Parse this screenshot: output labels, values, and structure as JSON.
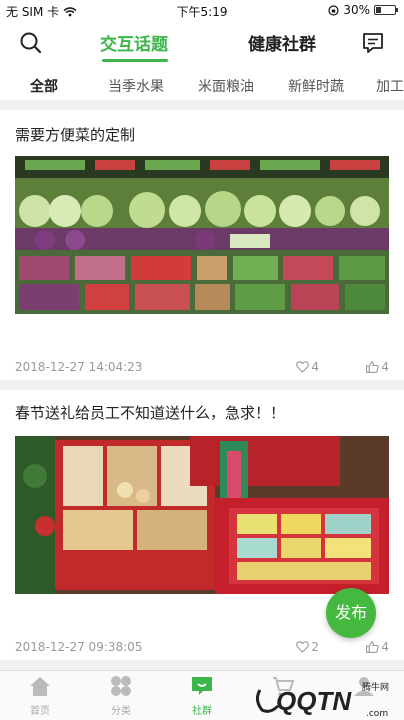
{
  "status": {
    "carrier": "无 SIM 卡",
    "time": "下午5:19",
    "battery": "30%",
    "battery_level": 0.3
  },
  "header": {
    "tabs": [
      {
        "label": "交互话题",
        "active": true
      },
      {
        "label": "健康社群",
        "active": false
      }
    ],
    "icons": {
      "search": "search-icon",
      "message": "message-icon"
    }
  },
  "categories": [
    "全部",
    "当季水果",
    "米面粮油",
    "新鲜时蔬",
    "加工"
  ],
  "posts": [
    {
      "title": "需要方便菜的定制",
      "date": "2018-12-27 14:04:23",
      "likes": "4",
      "thumbs": "4"
    },
    {
      "title": "春节送礼给员工不知道送什么，急求！！",
      "date": "2018-12-27 09:38:05",
      "likes": "2",
      "thumbs": "4"
    }
  ],
  "publish_label": "发布",
  "bottom_nav": [
    {
      "label": "首页",
      "icon": "home-icon",
      "active": false
    },
    {
      "label": "分类",
      "icon": "category-icon",
      "active": false
    },
    {
      "label": "社群",
      "icon": "community-icon",
      "active": true
    },
    {
      "label": "",
      "icon": "cart-icon",
      "active": false
    },
    {
      "label": "",
      "icon": "profile-icon",
      "active": false
    }
  ],
  "watermark": {
    "brand": "QQTN",
    "sub": "腾牛网",
    "url": ".com"
  },
  "colors": {
    "accent": "#3cb54a",
    "gap": "#f1f1f1"
  }
}
